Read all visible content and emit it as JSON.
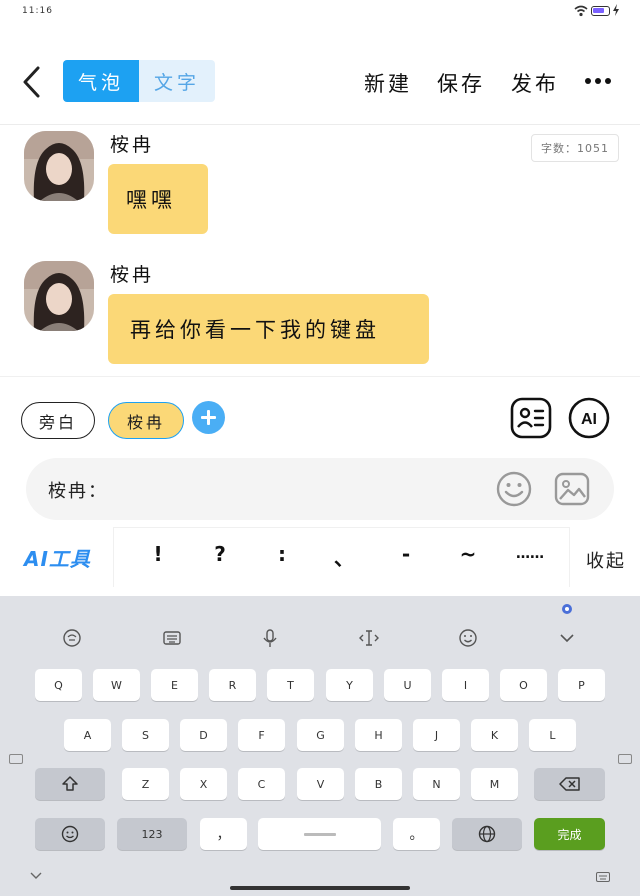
{
  "status": {
    "time": "11:16"
  },
  "nav": {
    "tab_bubble": "气泡",
    "tab_text": "文字",
    "new": "新建",
    "save": "保存",
    "publish": "发布"
  },
  "word_count": "字数：1051",
  "messages": [
    {
      "sender": "桉冉",
      "text": "嘿嘿"
    },
    {
      "sender": "桉冉",
      "text": "再给你看一下我的键盘"
    }
  ],
  "composer": {
    "narration_chip": "旁白",
    "role_chip": "桉冉",
    "ai_icon": "AI",
    "input_prefix": "桉冉：",
    "ai_tools": "AI工具",
    "punctuation": [
      "!",
      "?",
      ":",
      "、",
      "-",
      "~",
      "……"
    ],
    "collapse": "收起"
  },
  "keyboard": {
    "row1": [
      "Q",
      "W",
      "E",
      "R",
      "T",
      "Y",
      "U",
      "I",
      "O",
      "P"
    ],
    "row2": [
      "A",
      "S",
      "D",
      "F",
      "G",
      "H",
      "J",
      "K",
      "L"
    ],
    "row3": [
      "Z",
      "X",
      "C",
      "V",
      "B",
      "N",
      "M"
    ],
    "num_key": "123",
    "comma_key": "，",
    "period_key": "。",
    "done_key": "完成"
  },
  "icons": {
    "back": "chevron-left-icon",
    "more": "more-dots-icon",
    "contact_card": "contact-card-icon",
    "emoji": "emoji-icon",
    "image": "image-icon",
    "shift": "shift-icon",
    "backspace": "backspace-icon",
    "globe": "globe-icon",
    "mic": "mic-icon"
  },
  "colors": {
    "accent": "#1da1f2",
    "bubble": "#fbd877",
    "done_key": "#5a9e1f",
    "keyboard_bg": "#dfe1e6"
  }
}
